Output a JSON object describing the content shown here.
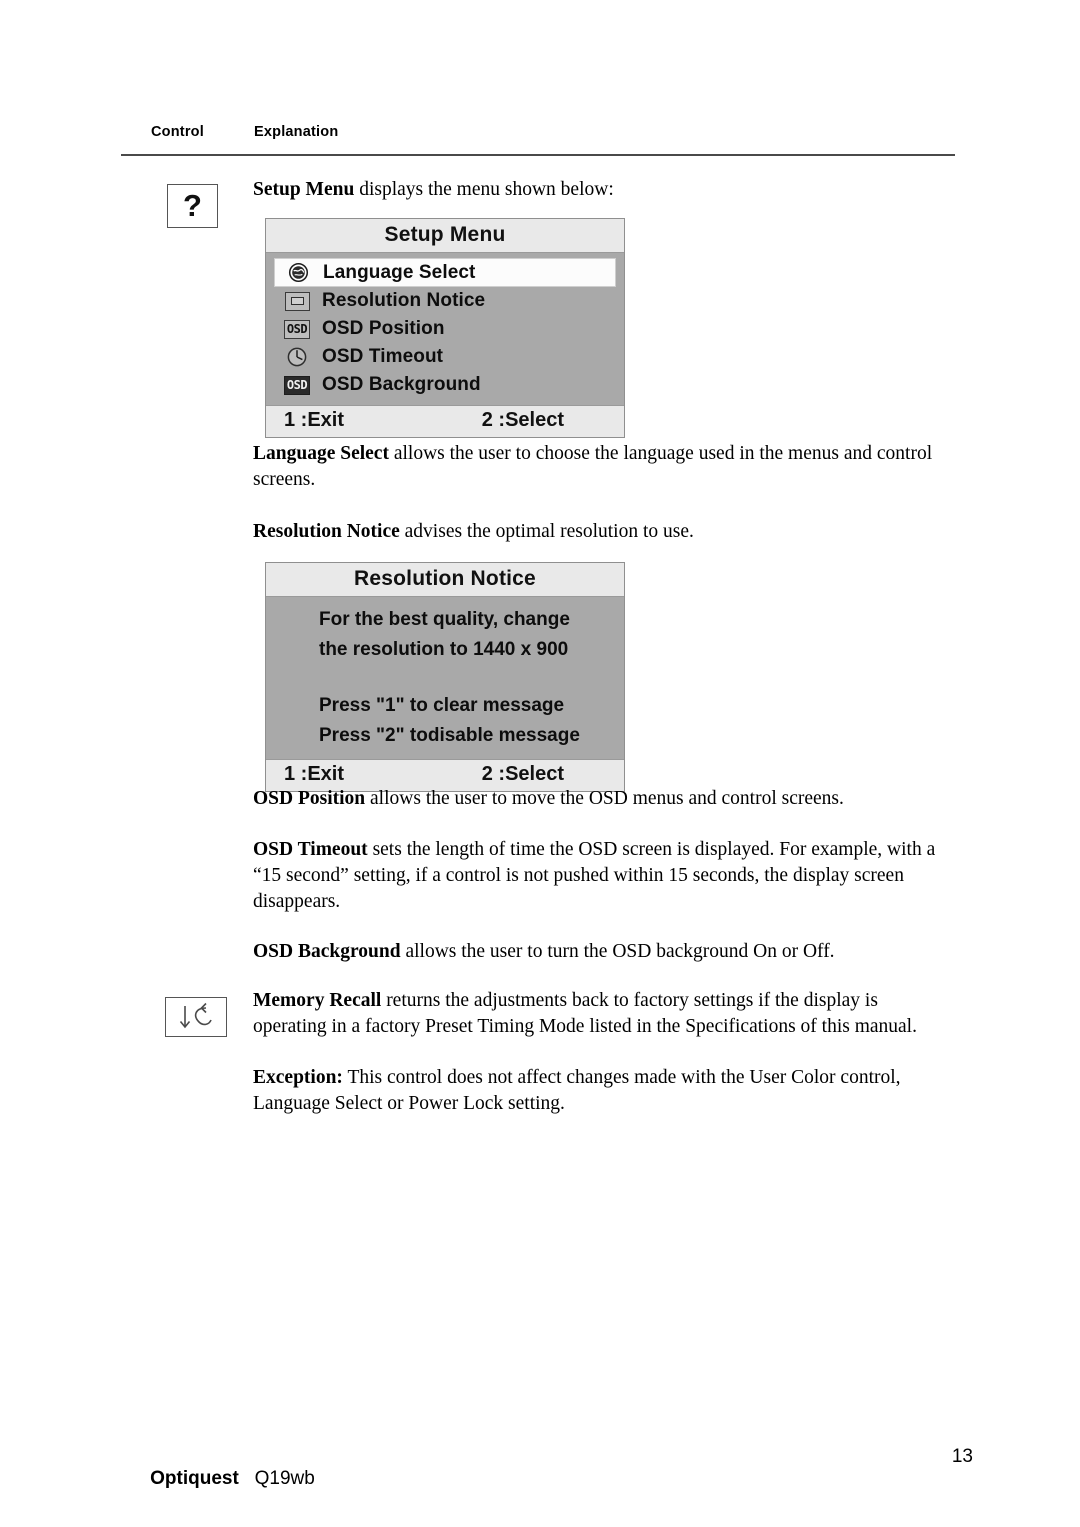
{
  "header": {
    "control_label": "Control",
    "explanation_label": "Explanation"
  },
  "gutter_icons": {
    "help_glyph": "?",
    "help_icon_name": "question-mark-icon",
    "recall_icon_name": "memory-recall-arrow-icon"
  },
  "paragraphs": {
    "setup_menu_intro_bold": "Setup Menu",
    "setup_menu_intro_rest": " displays the menu shown below:",
    "language_select_bold": "Language Select",
    "language_select_rest": " allows the user to choose the language used in the menus and control screens.",
    "resolution_notice_bold": "Resolution Notice",
    "resolution_notice_rest": " advises the optimal resolution to use.",
    "osd_position_bold": "OSD Position",
    "osd_position_rest": " allows the user to move the OSD menus and control screens.",
    "osd_timeout_bold": "OSD Timeout",
    "osd_timeout_rest": " sets the length of time the OSD screen is displayed. For example, with a “15 second” setting, if a control is not pushed within 15 seconds, the display screen disappears.",
    "osd_background_bold": "OSD Background",
    "osd_background_rest": " allows the user to turn the OSD background On or Off.",
    "memory_recall_bold": "Memory Recall",
    "memory_recall_rest": " returns the adjustments back to factory settings if the display is operating in a factory Preset Timing Mode listed in the Specifications of this manual.",
    "exception_bold": "Exception:",
    "exception_rest": " This control does not affect changes made with the User Color control, Language Select or Power Lock setting."
  },
  "setup_menu_osd": {
    "title": "Setup Menu",
    "items": [
      {
        "label": "Language Select",
        "icon": "globe-icon",
        "selected": true
      },
      {
        "label": "Resolution Notice",
        "icon": "monitor-icon",
        "selected": false
      },
      {
        "label": "OSD Position",
        "icon": "osd-text-icon",
        "selected": false
      },
      {
        "label": "OSD Timeout",
        "icon": "clock-icon",
        "selected": false
      },
      {
        "label": "OSD Background",
        "icon": "osd-inverted-icon",
        "selected": false
      }
    ],
    "footer_left": "1 :Exit",
    "footer_right": "2 :Select"
  },
  "resolution_notice_osd": {
    "title": "Resolution Notice",
    "lines": [
      "For the best quality, change",
      "the resolution to 1440 x 900"
    ],
    "lines2": [
      "Press \"1\" to clear message",
      "Press \"2\" todisable message"
    ],
    "footer_left": "1 :Exit",
    "footer_right": "2 :Select"
  },
  "footer": {
    "brand": "Optiquest",
    "model": "Q19wb",
    "page_number": "13"
  },
  "colors": {
    "osd_title_bg": "#e9e9e9",
    "osd_body_bg": "#a9a9a9",
    "osd_selected_bg": "#fcfcfc",
    "rule": "#4a4a4a",
    "text": "#000000"
  }
}
